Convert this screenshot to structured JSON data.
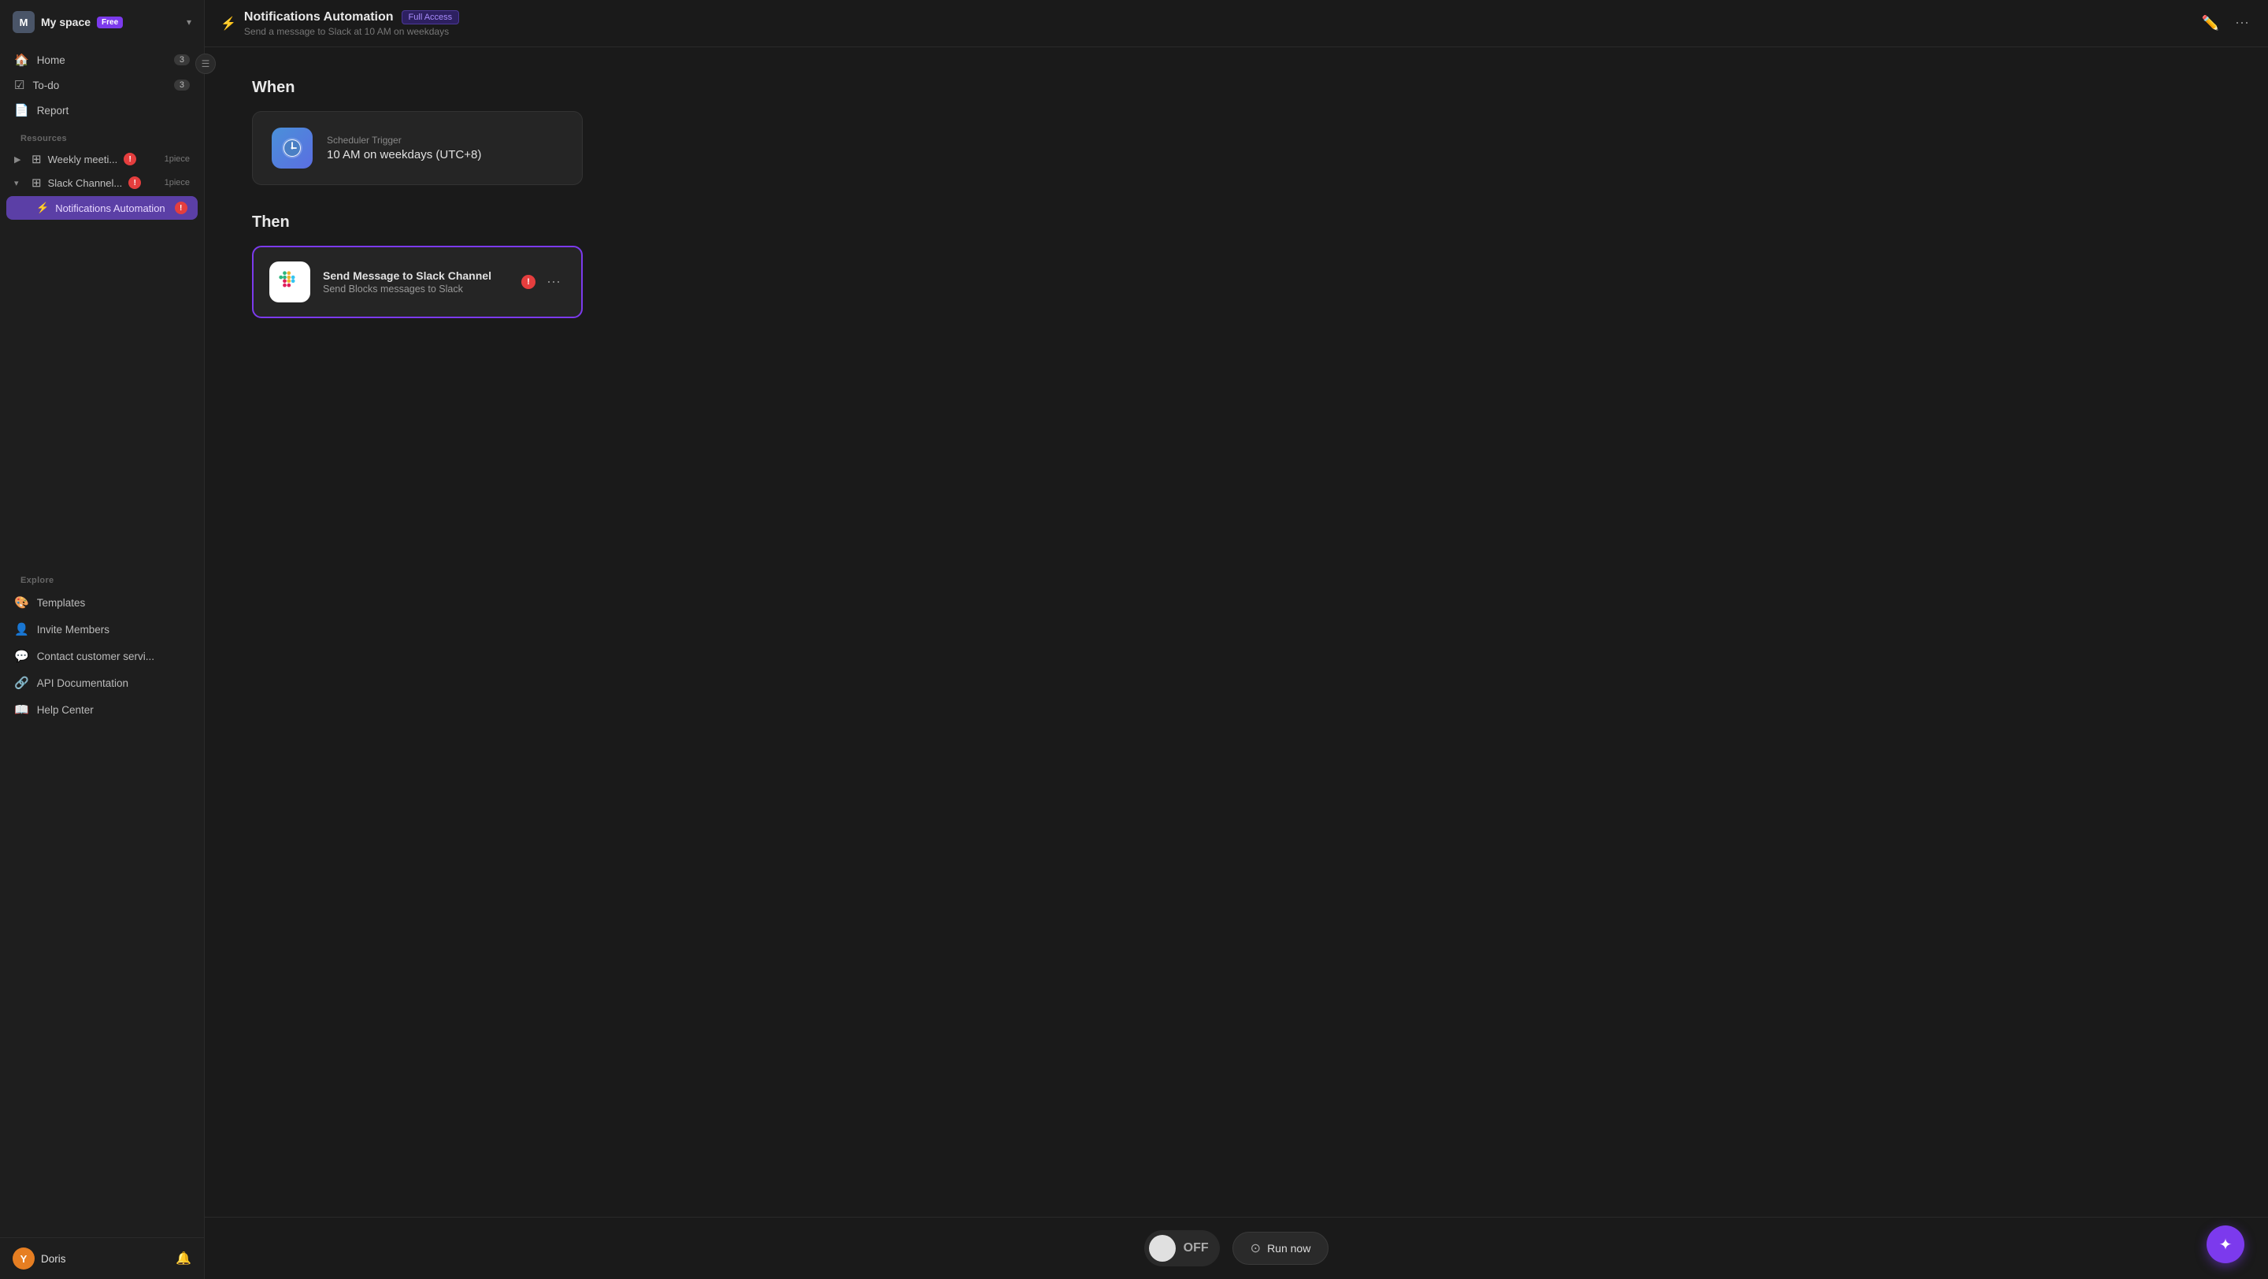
{
  "workspace": {
    "avatar_letter": "M",
    "name": "My space",
    "plan": "Free"
  },
  "sidebar": {
    "nav_items": [
      {
        "id": "home",
        "icon": "🏠",
        "label": "Home",
        "badge": "3"
      },
      {
        "id": "todo",
        "icon": "☑️",
        "label": "To-do",
        "badge": "3"
      },
      {
        "id": "report",
        "icon": "📄",
        "label": "Report",
        "badge": ""
      }
    ],
    "resources_label": "Resources",
    "resources": [
      {
        "id": "weekly",
        "label": "Weekly meeti...",
        "has_err": true,
        "piece": "1piece",
        "expanded": false
      },
      {
        "id": "slack",
        "label": "Slack Channel...",
        "has_err": true,
        "piece": "1piece",
        "expanded": true
      }
    ],
    "automation": {
      "icon": "⚡",
      "label": "Notifications Automation",
      "has_err": true
    },
    "explore_label": "Explore",
    "explore_items": [
      {
        "id": "templates",
        "icon": "🎨",
        "label": "Templates"
      },
      {
        "id": "invite",
        "icon": "👤",
        "label": "Invite Members"
      },
      {
        "id": "contact",
        "icon": "💬",
        "label": "Contact customer servi..."
      },
      {
        "id": "api",
        "icon": "🔗",
        "label": "API Documentation"
      },
      {
        "id": "help",
        "icon": "📖",
        "label": "Help Center"
      }
    ]
  },
  "user": {
    "avatar_letter": "Y",
    "name": "Doris"
  },
  "topbar": {
    "icon": "⚡",
    "title": "Notifications Automation",
    "badge": "Full Access",
    "subtitle": "Send a message to Slack at 10 AM on weekdays",
    "edit_tooltip": "Edit",
    "more_tooltip": "More"
  },
  "when_section": {
    "title": "When",
    "trigger": {
      "icon": "🕐",
      "label": "Scheduler Trigger",
      "value": "10 AM on weekdays (UTC+8)"
    }
  },
  "then_section": {
    "title": "Then",
    "action": {
      "title": "Send Message to Slack Channel",
      "subtitle": "Send Blocks messages to Slack",
      "has_err": true
    }
  },
  "bottom_bar": {
    "toggle_state": "OFF",
    "run_now_label": "Run now"
  },
  "fab": {
    "icon": "✦"
  }
}
